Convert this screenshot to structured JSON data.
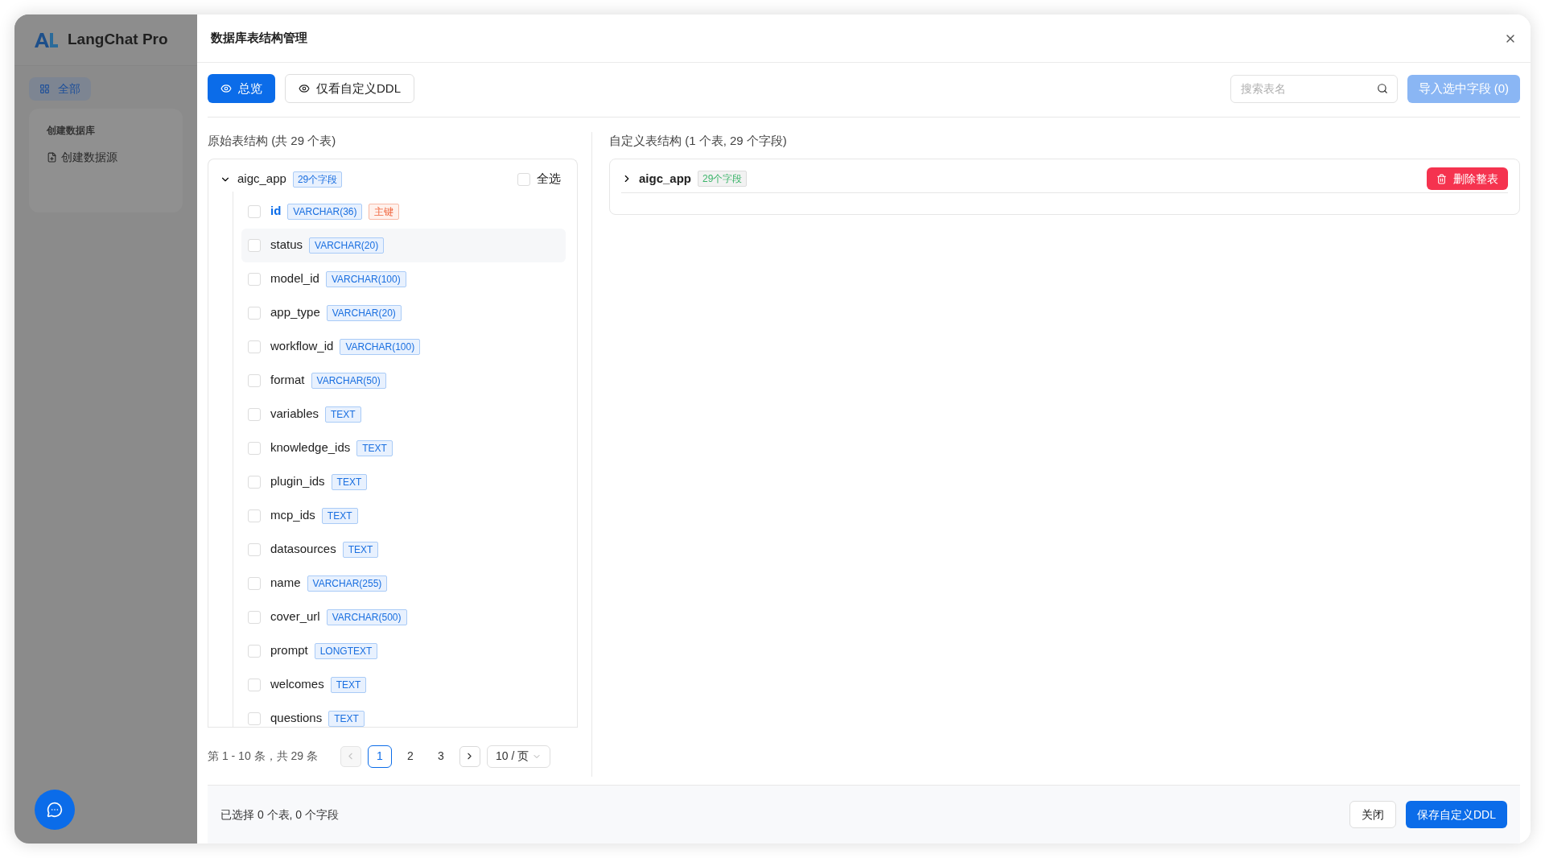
{
  "sidebar": {
    "brand": "LangChat Pro",
    "nav": [
      {
        "label": "全部",
        "selected": true
      }
    ],
    "group": {
      "title": "创建数据库",
      "items": [
        {
          "label": "创建数据源"
        }
      ]
    }
  },
  "modal": {
    "title": "数据库表结构管理",
    "tabs": [
      {
        "label": "总览",
        "selected": true
      },
      {
        "label": "仅看自定义DDL",
        "selected": false
      }
    ],
    "search": {
      "placeholder": "搜索表名"
    },
    "import_button": {
      "label": "导入选中字段 (0)",
      "disabled": true
    },
    "left": {
      "heading": "原始表结构 (共 29 个表)",
      "table": {
        "name": "aigc_app",
        "badge": "29个字段",
        "expanded": true,
        "select_all": {
          "label": "全选",
          "checked": false
        },
        "fields": [
          {
            "name": "id",
            "type": "VARCHAR(36)",
            "tag": "主键",
            "primary_key": true,
            "checked": false,
            "highlighted": false
          },
          {
            "name": "status",
            "type": "VARCHAR(20)",
            "primary_key": false,
            "checked": false,
            "highlighted": true
          },
          {
            "name": "model_id",
            "type": "VARCHAR(100)",
            "primary_key": false,
            "checked": false,
            "highlighted": false
          },
          {
            "name": "app_type",
            "type": "VARCHAR(20)",
            "primary_key": false,
            "checked": false,
            "highlighted": false
          },
          {
            "name": "workflow_id",
            "type": "VARCHAR(100)",
            "primary_key": false,
            "checked": false,
            "highlighted": false
          },
          {
            "name": "format",
            "type": "VARCHAR(50)",
            "primary_key": false,
            "checked": false,
            "highlighted": false
          },
          {
            "name": "variables",
            "type": "TEXT",
            "primary_key": false,
            "checked": false,
            "highlighted": false
          },
          {
            "name": "knowledge_ids",
            "type": "TEXT",
            "primary_key": false,
            "checked": false,
            "highlighted": false
          },
          {
            "name": "plugin_ids",
            "type": "TEXT",
            "primary_key": false,
            "checked": false,
            "highlighted": false
          },
          {
            "name": "mcp_ids",
            "type": "TEXT",
            "primary_key": false,
            "checked": false,
            "highlighted": false
          },
          {
            "name": "datasources",
            "type": "TEXT",
            "primary_key": false,
            "checked": false,
            "highlighted": false
          },
          {
            "name": "name",
            "type": "VARCHAR(255)",
            "primary_key": false,
            "checked": false,
            "highlighted": false
          },
          {
            "name": "cover_url",
            "type": "VARCHAR(500)",
            "primary_key": false,
            "checked": false,
            "highlighted": false
          },
          {
            "name": "prompt",
            "type": "LONGTEXT",
            "primary_key": false,
            "checked": false,
            "highlighted": false
          },
          {
            "name": "welcomes",
            "type": "TEXT",
            "primary_key": false,
            "checked": false,
            "highlighted": false
          },
          {
            "name": "questions",
            "type": "TEXT",
            "primary_key": false,
            "checked": false,
            "highlighted": false
          }
        ]
      },
      "pagination": {
        "summary": "第 1 - 10 条，共 29 条",
        "prev_disabled": true,
        "pages": [
          {
            "label": "1",
            "selected": true
          },
          {
            "label": "2",
            "selected": false
          },
          {
            "label": "3",
            "selected": false
          }
        ],
        "page_size": "10 / 页"
      }
    },
    "right": {
      "heading": "自定义表结构 (1 个表, 29 个字段)",
      "tables": [
        {
          "name": "aigc_app",
          "badge": "29个字段",
          "expanded": false,
          "delete_label": "删除整表"
        }
      ]
    },
    "footer": {
      "summary": "已选择 0 个表, 0 个字段",
      "buttons": [
        {
          "label": "关闭",
          "kind": "default"
        },
        {
          "label": "保存自定义DDL",
          "kind": "primary"
        }
      ]
    }
  }
}
